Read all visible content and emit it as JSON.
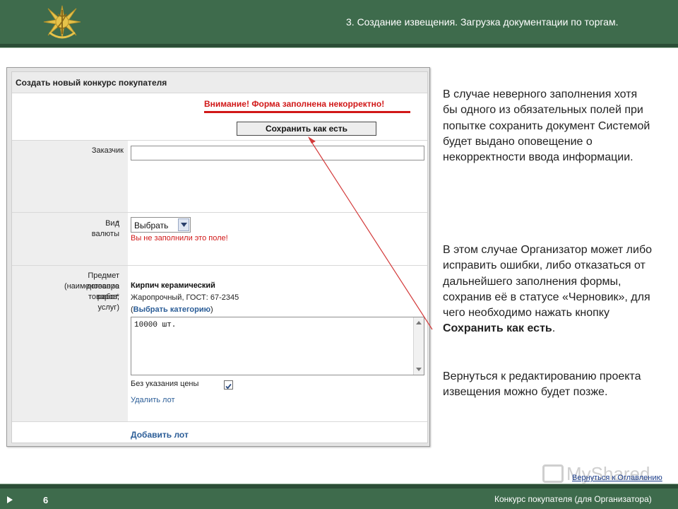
{
  "header": {
    "title": "3. Создание извещения. Загрузка документации по торгам."
  },
  "form": {
    "heading": "Создать новый конкурс покупателя",
    "warning": "Внимание! Форма заполнена некорректно!",
    "save_button": "Сохранить как есть",
    "customer_label": "Заказчик",
    "currency_label": "Вид валюты",
    "currency_value": "Выбрать",
    "currency_error": "Вы не заполнили это поле!",
    "subject_label_1": "Предмет договора",
    "subject_label_2": "(наименование товаров,",
    "subject_label_3": "работ, услуг)",
    "required_mark": "*",
    "product_name": "Кирпич керамический",
    "product_desc": "Жаропрочный, ГОСТ: 67-2345",
    "category_open": "(",
    "category_link": "Выбрать категорию",
    "category_close": ")",
    "quantity": "10000 шт.",
    "no_price_label": "Без указания цены",
    "no_price_checked": true,
    "delete_lot": "Удалить лот",
    "add_lot": "Добавить лот"
  },
  "description": {
    "p1": "В случае неверного заполнения хотя бы одного из обязательных полей при попытке сохранить документ Системой будет выдано оповещение о некорректности ввода информации.",
    "p2_text": "В этом случае Организатор может либо исправить ошибки, либо отказаться от дальнейшего заполнения формы, сохранив её в статусе «Черновик», для чего необходимо нажать кнопку",
    "p2_bold": "Сохранить как есть",
    "p2_end": ".",
    "p3": "Вернуться к редактированию проекта извещения можно будет позже."
  },
  "watermark": "MyShared",
  "back_link": "Вернуться к Оглавлению",
  "footer": {
    "page_number": "6",
    "text": "Конкурс покупателя (для Организатора)"
  },
  "colors": {
    "band": "#3e6b4c",
    "band_dark": "#2b4d36",
    "error": "#d11818",
    "link": "#2b5d97"
  }
}
